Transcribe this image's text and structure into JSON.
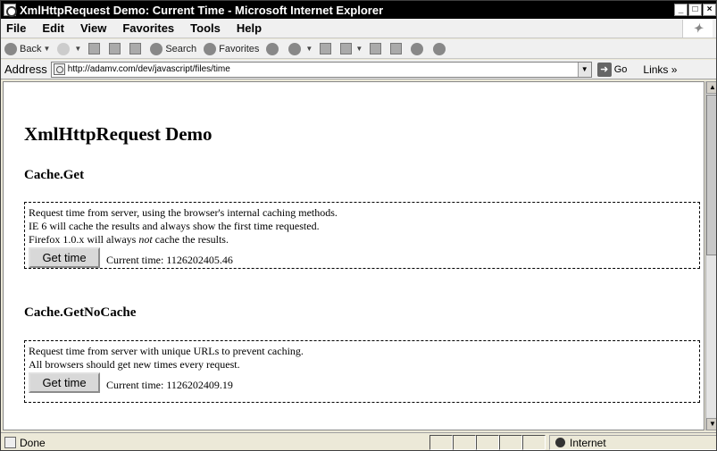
{
  "window": {
    "title": "XmlHttpRequest Demo: Current Time - Microsoft Internet Explorer"
  },
  "menu": {
    "items": [
      "File",
      "Edit",
      "View",
      "Favorites",
      "Tools",
      "Help"
    ]
  },
  "toolbar": {
    "back_label": "Back",
    "search_label": "Search",
    "favorites_label": "Favorites"
  },
  "address": {
    "label": "Address",
    "url": "http://adamv.com/dev/javascript/files/time",
    "go_label": "Go",
    "links_label": "Links »"
  },
  "page": {
    "heading": "XmlHttpRequest Demo",
    "sections": [
      {
        "title": "Cache.Get",
        "lines": [
          "Request time from server, using the browser's internal caching methods.",
          "IE 6 will cache the results and always show the first time requested."
        ],
        "line3_before": "Firefox 1.0.x will always ",
        "line3_em": "not",
        "line3_after": " cache the results.",
        "button_label": "Get time",
        "time_text": "Current time: 1126202405.46"
      },
      {
        "title": "Cache.GetNoCache",
        "lines": [
          "Request time from server with unique URLs to prevent caching.",
          "All browsers should get new times every request."
        ],
        "button_label": "Get time",
        "time_text": "Current time: 1126202409.19"
      }
    ]
  },
  "status": {
    "text": "Done",
    "zone": "Internet"
  }
}
